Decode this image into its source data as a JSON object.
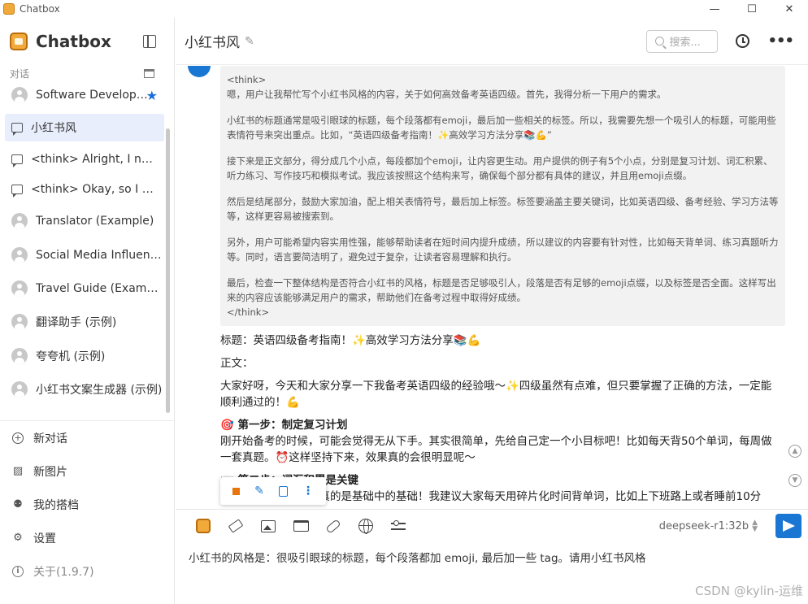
{
  "window": {
    "title": "Chatbox",
    "minimize": "—",
    "maximize": "☐",
    "close": "✕"
  },
  "sidebar": {
    "brand": "Chatbox",
    "section_label": "对话",
    "conversations": [
      {
        "label": "Software Develop…",
        "type": "avatar",
        "starred": true
      },
      {
        "label": "小红书风",
        "type": "chat",
        "active": true
      },
      {
        "label": "<think> Alright, I need t…",
        "type": "chat"
      },
      {
        "label": "<think> Okay, so I nee…",
        "type": "chat"
      },
      {
        "label": "Translator (Example)",
        "type": "avatar"
      },
      {
        "label": "Social Media Influence…",
        "type": "avatar"
      },
      {
        "label": "Travel Guide (Example)",
        "type": "avatar"
      },
      {
        "label": "翻译助手 (示例)",
        "type": "avatar"
      },
      {
        "label": "夸夸机 (示例)",
        "type": "avatar"
      },
      {
        "label": "小红书文案生成器 (示例)",
        "type": "avatar"
      }
    ],
    "menu": [
      {
        "label": "新对话",
        "icon": "plus-circle-icon"
      },
      {
        "label": "新图片",
        "icon": "image-plus-icon"
      },
      {
        "label": "我的搭档",
        "icon": "robot-icon"
      },
      {
        "label": "设置",
        "icon": "gear-icon"
      },
      {
        "label": "关于(1.9.7)",
        "icon": "info-icon"
      }
    ]
  },
  "header": {
    "title": "小红书风",
    "search_placeholder": "搜索..."
  },
  "think": {
    "open_tag": "<think>",
    "paragraphs": [
      "嗯，用户让我帮忙写个小红书风格的内容，关于如何高效备考英语四级。首先，我得分析一下用户的需求。",
      "小红书的标题通常是吸引眼球的标题，每个段落都有emoji，最后加一些相关的标签。所以，我需要先想一个吸引人的标题，可能用些表情符号来突出重点。比如，“英语四级备考指南！✨高效学习方法分享📚💪”",
      "接下来是正文部分，得分成几个小点，每段都加个emoji，让内容更生动。用户提供的例子有5个小点，分别是复习计划、词汇积累、听力练习、写作技巧和模拟考试。我应该按照这个结构来写，确保每个部分都有具体的建议，并且用emoji点缀。",
      "然后是结尾部分，鼓励大家加油，配上相关表情符号，最后加上标签。标签要涵盖主要关键词，比如英语四级、备考经验、学习方法等等，这样更容易被搜索到。",
      "另外，用户可能希望内容实用性强，能够帮助读者在短时间内提升成绩，所以建议的内容要有针对性，比如每天背单词、练习真题听力等。同时，语言要简洁明了，避免过于复杂，让读者容易理解和执行。",
      "最后，检查一下整体结构是否符合小红书的风格，标题是否足够吸引人，段落是否有足够的emoji点缀，以及标签是否全面。这样写出来的内容应该能够满足用户的需求，帮助他们在备考过程中取得好成绩。"
    ],
    "close_tag": "</think>"
  },
  "answer": {
    "title_line": "标题：英语四级备考指南！✨高效学习方法分享📚💪",
    "body_label": "正文：",
    "intro": "大家好呀，今天和大家分享一下我备考英语四级的经验哦～✨四级虽然有点难，但只要掌握了正确的方法，一定能顺利通过的！💪",
    "step1_heading": "🎯 第一步：制定复习计划",
    "step1_text": "刚开始备考的时候，可能会觉得无从下手。其实很简单，先给自己定一个小目标吧！比如每天背50个单词，每周做一套真题。⏰这样坚持下来，效果真的会很明显呢～",
    "step2_heading": "📖 第二步：词汇积累是关键",
    "step2_text": "四级考试中，词汇量真的是基础中的基础！我建议大家每天用碎片化时间背单词，比如上下班路上或者睡前10分"
  },
  "composer": {
    "model": "deepseek-r1:32b",
    "input_text": "小红书的风格是：很吸引眼球的标题，每个段落都加 emoji, 最后加一些 tag。请用小红书风格"
  },
  "watermark": "CSDN @kylin-运维",
  "colors": {
    "accent": "#1976d2",
    "active_bg": "#e8eefc",
    "think_bg": "#f2f2f2",
    "stop": "#e8750b"
  }
}
